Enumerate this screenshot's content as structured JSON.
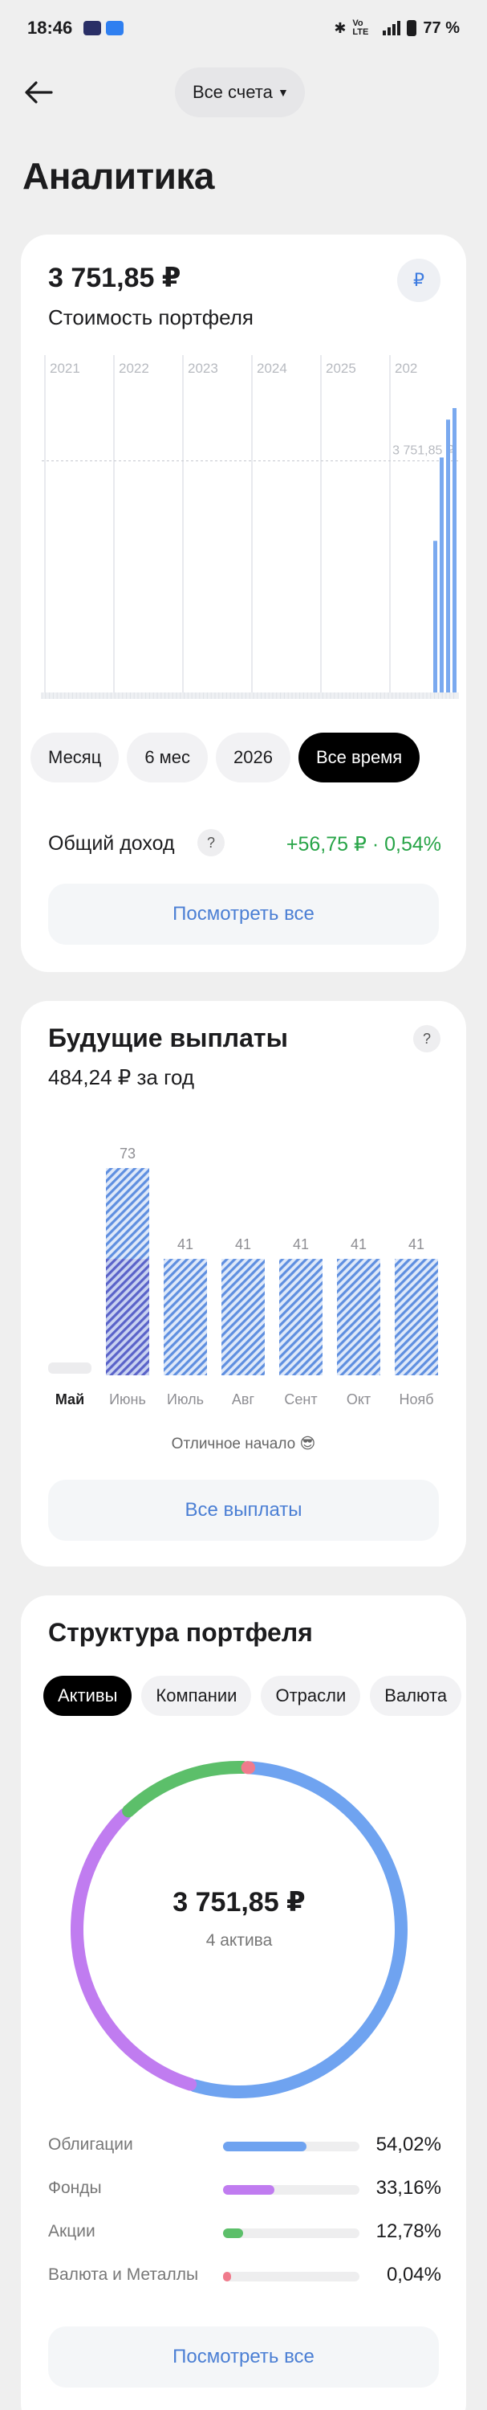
{
  "status_bar": {
    "time": "18:46",
    "network": "Vo LTE",
    "battery": "77 %"
  },
  "nav": {
    "back_icon": "arrow-left-icon",
    "account_selector": "Все счета"
  },
  "page_title": "Аналитика",
  "portfolio": {
    "value": "3 751,85 ₽",
    "subtitle": "Стоимость портфеля",
    "currency_badge": "₽",
    "chart_data": {
      "type": "bar",
      "x_ticks": [
        "2021",
        "2022",
        "2023",
        "2024",
        "2025",
        "202"
      ],
      "reference_label": "3 751,85 ₽",
      "x": [
        "2025-11",
        "2025-12",
        "2026-01",
        "2026-02"
      ],
      "values": [
        2000,
        3100,
        3600,
        3751.85
      ],
      "ylim": [
        0,
        3900
      ],
      "color": "#7aa9ef"
    },
    "periods": [
      {
        "label": "Месяц",
        "active": false
      },
      {
        "label": "6 мес",
        "active": false
      },
      {
        "label": "2026",
        "active": false
      },
      {
        "label": "Все время",
        "active": true
      }
    ],
    "income_label": "Общий доход",
    "income_help": "?",
    "income_value": "+56,75 ₽ · 0,54%",
    "view_all": "Посмотреть все"
  },
  "payouts": {
    "title": "Будущие выплаты",
    "help": "?",
    "subtitle": "484,24 ₽ за год",
    "chart_data": {
      "type": "bar",
      "categories": [
        "Май",
        "Июнь",
        "Июль",
        "Авг",
        "Сент",
        "Окт",
        "Нояб"
      ],
      "values": [
        0,
        73,
        41,
        41,
        41,
        41,
        41
      ],
      "value_labels": [
        "",
        "73",
        "41",
        "41",
        "41",
        "41",
        "41"
      ],
      "ylim": [
        0,
        73
      ],
      "current_category": "Май"
    },
    "note": "Отличное начало 😎",
    "all_button": "Все выплаты"
  },
  "structure": {
    "title": "Структура портфеля",
    "tabs": [
      {
        "label": "Активы",
        "active": true
      },
      {
        "label": "Компании",
        "active": false
      },
      {
        "label": "Отрасли",
        "active": false
      },
      {
        "label": "Валюта",
        "active": false
      }
    ],
    "total_value": "3 751,85 ₽",
    "total_sub": "4 актива",
    "chart_data": {
      "type": "pie",
      "labels": [
        "Облигации",
        "Фонды",
        "Акции",
        "Валюта и Металлы"
      ],
      "values": [
        54.02,
        33.16,
        12.78,
        0.04
      ],
      "percent_labels": [
        "54,02%",
        "33,16%",
        "12,78%",
        "0,04%"
      ],
      "colors": [
        "#6fa3f0",
        "#c07cf0",
        "#5cbf6a",
        "#f07b8c"
      ]
    },
    "view_all": "Посмотреть все"
  }
}
